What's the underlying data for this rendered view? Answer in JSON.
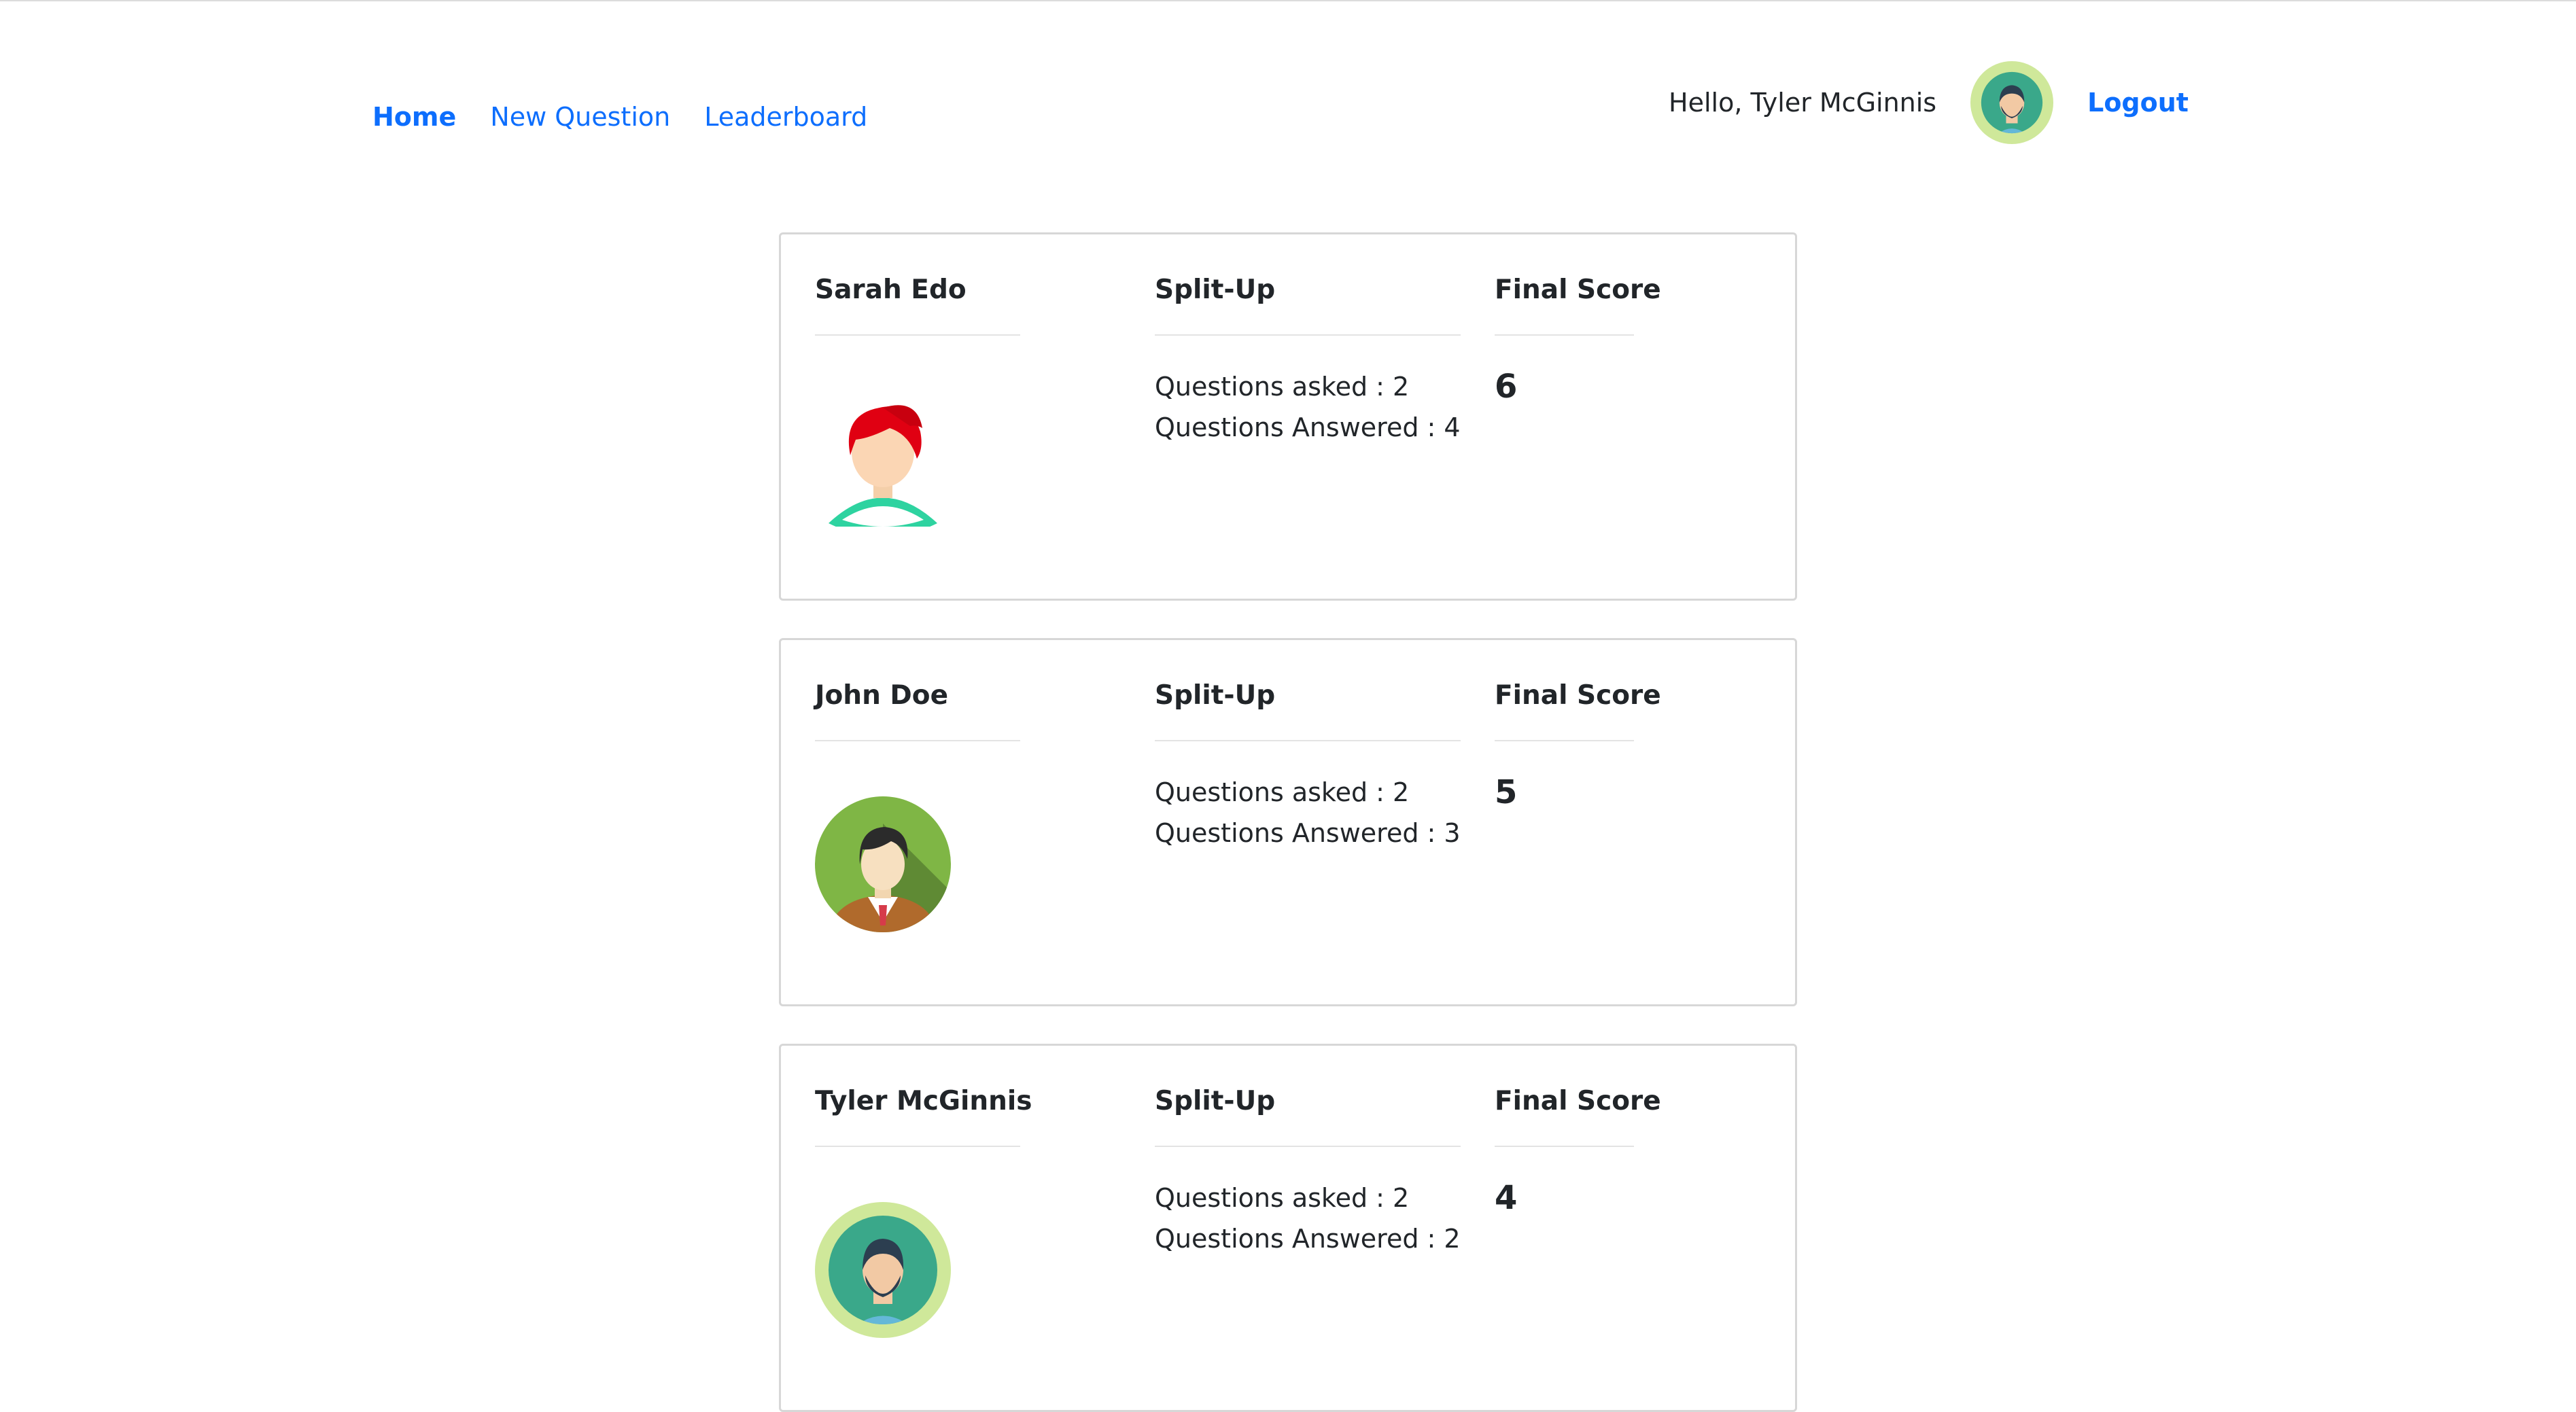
{
  "nav": {
    "links": [
      "Home",
      "New Question",
      "Leaderboard"
    ],
    "greeting": "Hello, Tyler McGinnis",
    "logout": "Logout"
  },
  "colors": {
    "link": "#0d6efd",
    "text": "#212529",
    "card_border": "#d7d7d7"
  },
  "leaderboard": [
    {
      "name": "Sarah Edo",
      "avatar_icon": "red-hair-woman-avatar-icon",
      "split_label": "Split-Up",
      "score_label": "Final Score",
      "asked_label": "Questions asked : 2",
      "answered_label": "Questions Answered : 4",
      "score": "6"
    },
    {
      "name": "John Doe",
      "avatar_icon": "man-in-suit-avatar-icon",
      "split_label": "Split-Up",
      "score_label": "Final Score",
      "asked_label": "Questions asked : 2",
      "answered_label": "Questions Answered : 3",
      "score": "5"
    },
    {
      "name": "Tyler McGinnis",
      "avatar_icon": "bearded-man-avatar-icon",
      "split_label": "Split-Up",
      "score_label": "Final Score",
      "asked_label": "Questions asked : 2",
      "answered_label": "Questions Answered : 2",
      "score": "4"
    }
  ]
}
